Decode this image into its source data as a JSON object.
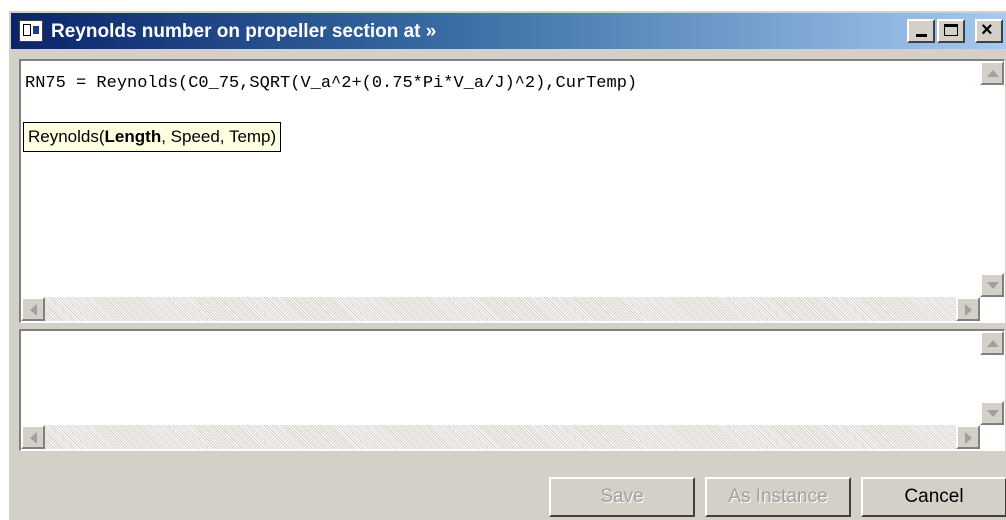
{
  "window": {
    "title": "Reynolds number on propeller section at »",
    "controls": {
      "minimize": "_",
      "maximize": "□",
      "close": "✕"
    }
  },
  "editor": {
    "code": "RN75 = Reynolds(C0_75,SQRT(V_a^2+(0.75*Pi*V_a/J)^2),CurTemp)",
    "tooltip": {
      "prefix": "Reynolds(",
      "highlight": "Length",
      "suffix": ", Speed, Temp)"
    }
  },
  "output": {
    "text": ""
  },
  "buttons": {
    "save": "Save",
    "as_instance": "As Instance",
    "cancel": "Cancel"
  },
  "icons": [
    "app-icon",
    "minimize-icon",
    "maximize-icon",
    "close-icon",
    "scroll-up-icon",
    "scroll-down-icon",
    "scroll-left-icon",
    "scroll-right-icon"
  ],
  "colors": {
    "title_start": "#0a246a",
    "title_end": "#a6caf0",
    "tooltip_bg": "#ffffe1",
    "face": "#d4d0c8"
  }
}
